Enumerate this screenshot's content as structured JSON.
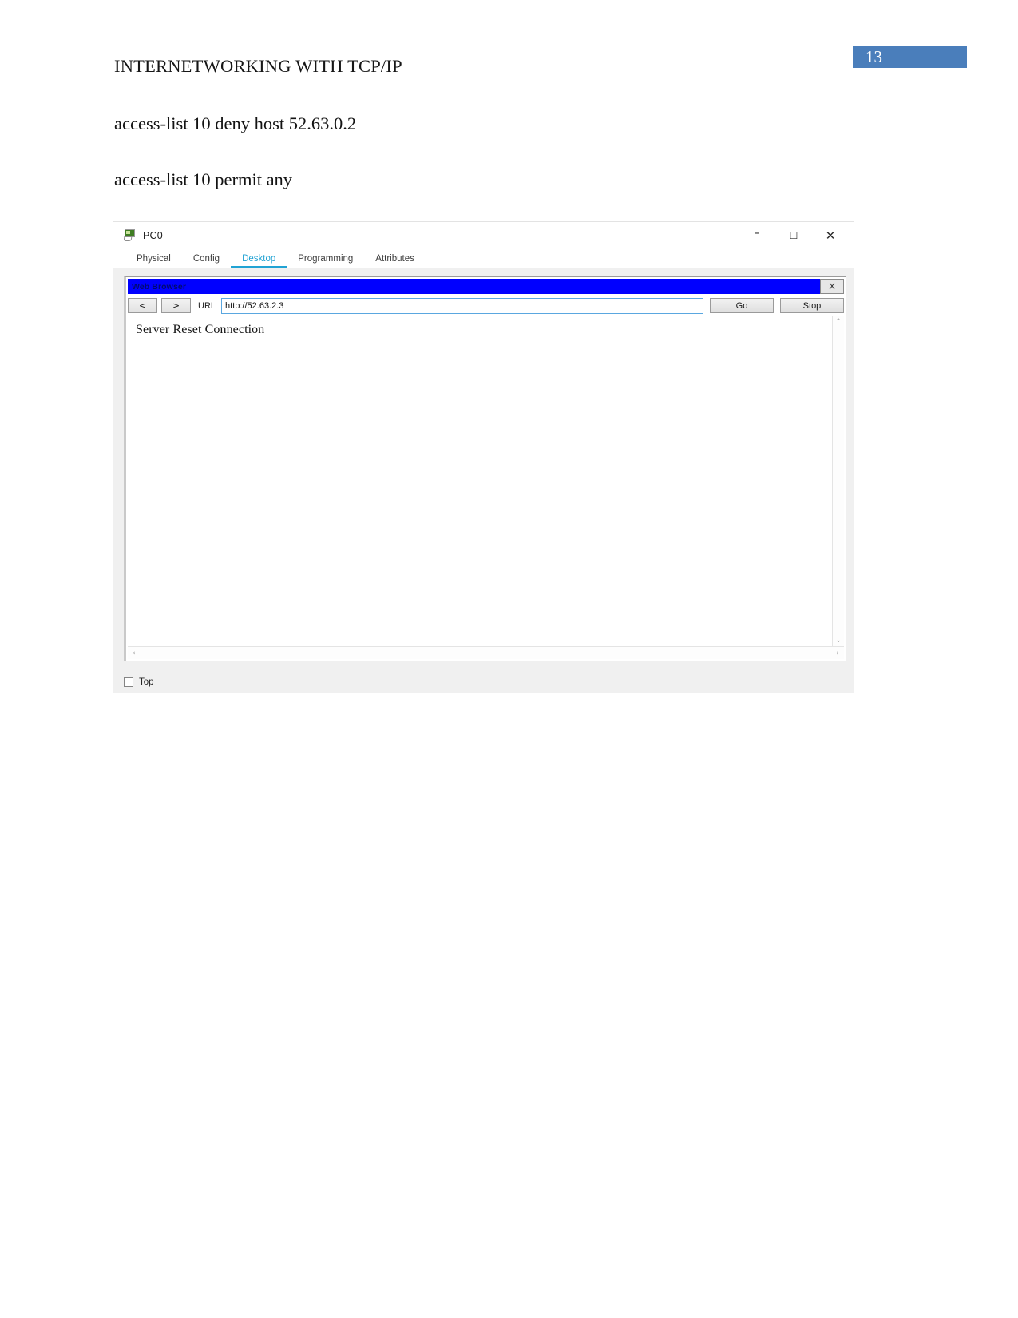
{
  "document": {
    "page_number": "13",
    "header": "INTERNETWORKING WITH TCP/IP",
    "lines": [
      "access-list 10 deny host 52.63.0.2",
      "access-list 10 permit any"
    ],
    "accent_color": "#4a7ebb"
  },
  "pt_window": {
    "title": "PC0",
    "icon": "pc-device-icon",
    "window_controls": {
      "minimize": "–",
      "maximize": "☐",
      "close": "✕"
    },
    "tabs": [
      {
        "label": "Physical",
        "active": false
      },
      {
        "label": "Config",
        "active": false
      },
      {
        "label": "Desktop",
        "active": true
      },
      {
        "label": "Programming",
        "active": false
      },
      {
        "label": "Attributes",
        "active": false
      }
    ],
    "active_tab_color": "#21a3d4",
    "browser": {
      "title": "Web Browser",
      "close_label": "X",
      "back_label": "<",
      "forward_label": ">",
      "url_label": "URL",
      "url_value": "http://52.63.2.3",
      "go_label": "Go",
      "stop_label": "Stop",
      "page_message": "Server Reset Connection",
      "titlebar_color": "#0000ff",
      "scroll": {
        "up": "⌃",
        "down": "⌄",
        "left": "‹",
        "right": "›"
      }
    },
    "bottom": {
      "top_checkbox_label": "Top",
      "top_checkbox_checked": false
    }
  }
}
